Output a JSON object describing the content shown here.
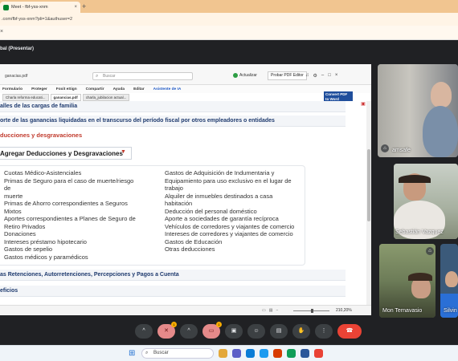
{
  "browser": {
    "tab_title": "Meet - fbf-yss-xnm",
    "tab_close": "×",
    "new_tab": "+",
    "url": ".com/fbf-yss-xnm?pli=1&authuser=2",
    "bookmark_icon": "×"
  },
  "meet": {
    "header": "bal (Presentar)"
  },
  "app": {
    "filename": "ganacias.pdf",
    "search_placeholder": "Buscar",
    "update_label": "Actualizar",
    "editor_label": "Probar PDF Editor",
    "menu": [
      "Formulario",
      "Proteger",
      "Foxit eSign",
      "Compartir",
      "Ayuda",
      "Editar",
      "Asistente de IA"
    ],
    "doc_tabs": [
      "Charla reforma educati...",
      "ganancias.pdf",
      "charla_jubilacion actual..."
    ],
    "convert_label": "Convert PDF to Word",
    "zoom": "210,20%"
  },
  "document": {
    "sections": [
      "alles de las cargas de familia",
      "orte de las ganancias liquidadas en el transcurso del período fiscal por otros empleadores o entidades",
      "as Retenciones, Autorretenciones, Percepciones y Pagos a Cuenta",
      "eficios"
    ],
    "red_heading": "ducciones y desgravaciones",
    "add_button": "Agregar Deducciones y Desgravaciones",
    "left_items": [
      "Cuotas Médico-Asistenciales",
      "Primas de Seguro para el caso de muerte/riesgo de",
      "muerte",
      "Primas de Ahorro correspondientes a Seguros",
      "Mixtos",
      "Aportes correspondientes a Planes de Seguro de",
      "Retiro Privados",
      "Donaciones",
      "Intereses préstamo hipotecario",
      "Gastos de sepelio",
      "Gastos médicos y paramédicos"
    ],
    "right_items": [
      "Gastos de Adquisición de Indumentaria y",
      "Equipamiento para uso exclusivo en el lugar de",
      "trabajo",
      "Alquiler de inmuebles destinados a casa habitación",
      "Deducción del personal doméstico",
      "Aporte a sociedades de garantía recíproca",
      "Vehículos de corredores y viajantes de comercio",
      "Intereses de corredores y viajantes de comercio",
      "Gastos de Educación",
      "Otras deducciones"
    ]
  },
  "participants": [
    {
      "name": "amsafe"
    },
    {
      "name": "Sebastián Vazquez"
    },
    {
      "name": "Mon Ternavasio"
    },
    {
      "name": "Silvin"
    }
  ],
  "controls": {
    "badge": "1"
  },
  "taskbar": {
    "search_label": "Buscar"
  }
}
